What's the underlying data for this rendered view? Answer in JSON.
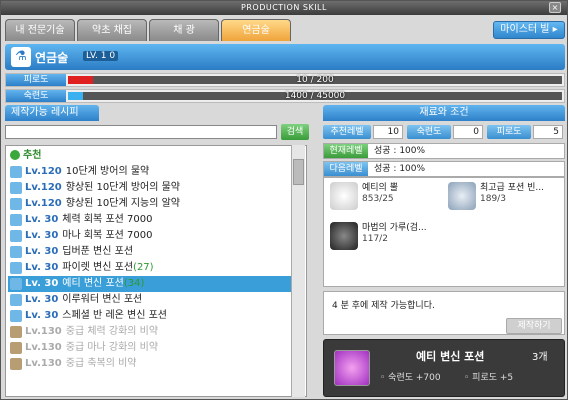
{
  "window": {
    "title": "PRODUCTION SKILL",
    "close": "×"
  },
  "tabs": [
    {
      "label": "내 전문기술",
      "active": false
    },
    {
      "label": "약초 채집",
      "active": false
    },
    {
      "label": "채 광",
      "active": false
    },
    {
      "label": "연금술",
      "active": true
    }
  ],
  "master_button": "마이스터 빌 ▸",
  "skill": {
    "name": "연금술",
    "level": "LV. 1 0"
  },
  "stats": {
    "fatigue": {
      "label": "피로도",
      "value": "10 / 200",
      "fraction": 0.05
    },
    "mastery": {
      "label": "숙련도",
      "value": "1400 / 45000",
      "fraction": 0.031
    }
  },
  "recipe_header": "제작가능 레시피",
  "search": {
    "button": "검색",
    "placeholder": ""
  },
  "category": "추천",
  "recipes": [
    {
      "lv": "Lv.120",
      "name": "10단계 방어의 물약",
      "extra": "",
      "state": "normal"
    },
    {
      "lv": "Lv.120",
      "name": "향상된 10단계 방어의 물약",
      "extra": "",
      "state": "normal"
    },
    {
      "lv": "Lv.120",
      "name": "향상된 10단계 지능의 알약",
      "extra": "",
      "state": "normal"
    },
    {
      "lv": "Lv.  30",
      "name": "체력 회복 포션 7000",
      "extra": "",
      "state": "normal"
    },
    {
      "lv": "Lv.  30",
      "name": "마나 회복 포션 7000",
      "extra": "",
      "state": "normal"
    },
    {
      "lv": "Lv.  30",
      "name": "딥버푼 변신 포션",
      "extra": "",
      "state": "normal"
    },
    {
      "lv": "Lv.  30",
      "name": "파이렛 변신 포션",
      "extra": "(27)",
      "state": "normal"
    },
    {
      "lv": "Lv.  30",
      "name": "예티 변신 포션",
      "extra": "(34)",
      "state": "selected"
    },
    {
      "lv": "Lv.  30",
      "name": "이루워터 변신 포션",
      "extra": "",
      "state": "normal"
    },
    {
      "lv": "Lv.  30",
      "name": "스페셜 반 레온 변신 포션",
      "extra": "",
      "state": "normal"
    },
    {
      "lv": "Lv.130",
      "name": "중급 체력 강화의 비약",
      "extra": "",
      "state": "locked"
    },
    {
      "lv": "Lv.130",
      "name": "중급 마나 강화의 비약",
      "extra": "",
      "state": "locked"
    },
    {
      "lv": "Lv.130",
      "name": "중급 축복의 비약",
      "extra": "",
      "state": "locked"
    }
  ],
  "materials_header": "재료와 조건",
  "conditions": {
    "recommended_level_label": "추천레벨",
    "recommended_level": "10",
    "mastery_label": "숙련도",
    "mastery": "0",
    "fatigue_label": "피로도",
    "fatigue": "5"
  },
  "levels": [
    {
      "label": "현재레벨",
      "text": "성공 : 100%"
    },
    {
      "label": "다음레벨",
      "text": "성공 : 100%"
    }
  ],
  "materials": [
    {
      "name": "예티의 뿔",
      "qty": "853/25"
    },
    {
      "name": "최고급 포션 빈...",
      "qty": "189/3"
    },
    {
      "name": "마법의 가루(검...",
      "qty": "117/2"
    }
  ],
  "message": "4 분 후에 제작 가능합니다.",
  "make_button": "제작하기",
  "result": {
    "name": "예티 변신 포션",
    "count": "3개",
    "mastery_gain": "숙련도 +700",
    "fatigue_gain": "피로도 +5"
  }
}
